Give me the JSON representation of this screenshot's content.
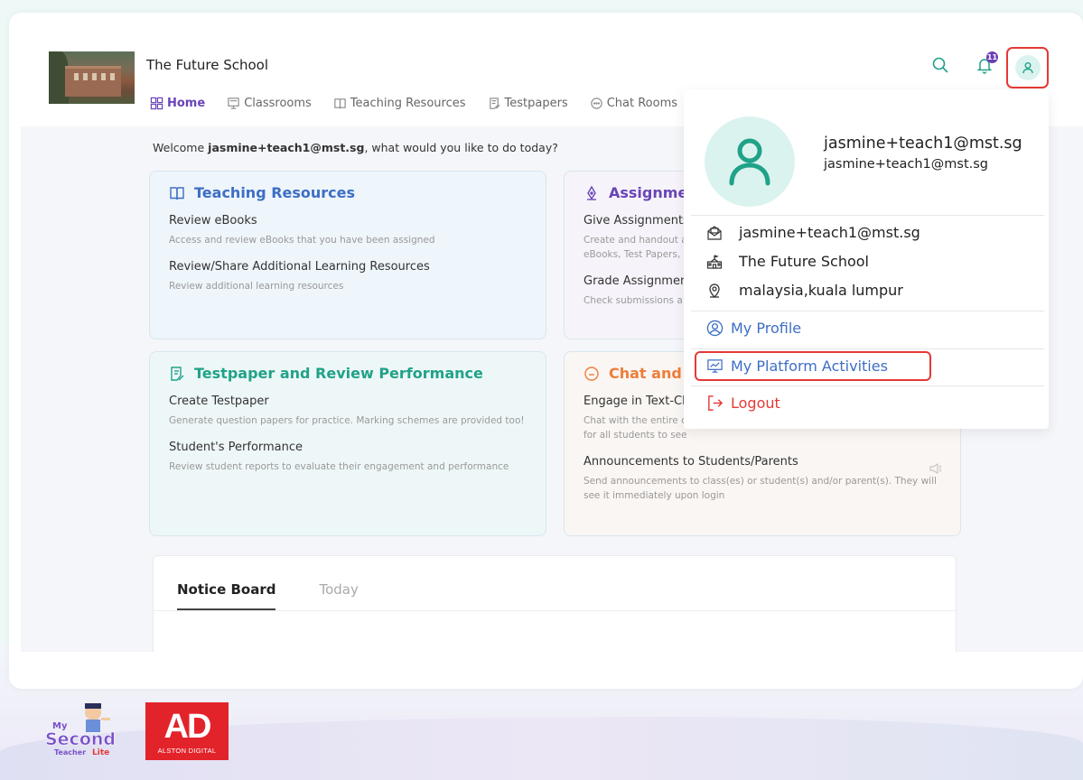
{
  "header": {
    "school_name": "The Future School",
    "notification_count": "11"
  },
  "nav": {
    "items": [
      {
        "label": "Home",
        "icon": "grid-icon",
        "active": true
      },
      {
        "label": "Classrooms",
        "icon": "classroom-icon"
      },
      {
        "label": "Teaching Resources",
        "icon": "book-icon"
      },
      {
        "label": "Testpapers",
        "icon": "testpaper-icon"
      },
      {
        "label": "Chat Rooms",
        "icon": "chat-icon"
      }
    ]
  },
  "welcome": {
    "prefix": "Welcome ",
    "user": "jasmine+teach1@mst.sg",
    "suffix": ", what would you like to do today?"
  },
  "tiles": {
    "teaching": {
      "title": "Teaching Resources",
      "items": [
        {
          "title": "Review eBooks",
          "desc": "Access and review eBooks that you have been assigned"
        },
        {
          "title": "Review/Share Additional Learning Resources",
          "desc": "Review additional learning resources"
        }
      ]
    },
    "assignments": {
      "title": "Assignmen",
      "items": [
        {
          "title": "Give Assignments",
          "desc": "Create and handout a",
          "desc2": "eBooks, Test Papers,"
        },
        {
          "title": "Grade Assignment",
          "desc": "Check submissions a"
        }
      ]
    },
    "testpaper": {
      "title": "Testpaper and Review Performance",
      "items": [
        {
          "title": "Create Testpaper",
          "desc": "Generate question papers for practice. Marking schemes are provided too!"
        },
        {
          "title": "Student's Performance",
          "desc": "Review student reports to evaluate their engagement and performance"
        }
      ]
    },
    "chat": {
      "title": "Chat and A",
      "items": [
        {
          "title": "Engage in Text-Ch",
          "desc": "Chat with the entire c",
          "desc2": "for all students to see"
        },
        {
          "title": "Announcements to Students/Parents",
          "desc": "Send announcements to class(es) or student(s) and/or parent(s). They will",
          "desc2": "see it immediately upon login"
        }
      ]
    }
  },
  "notice": {
    "tab_active": "Notice Board",
    "tab_inactive": "Today"
  },
  "dropdown": {
    "name": "jasmine+teach1@mst.sg",
    "email": "jasmine+teach1@mst.sg",
    "info_email": "jasmine+teach1@mst.sg",
    "info_school": "The Future School",
    "info_location": "malaysia,kuala lumpur",
    "my_profile": "My Profile",
    "my_platform_activities": "My Platform Activities",
    "logout": "Logout"
  },
  "footer": {
    "ad_logo_text": "AD",
    "ad_logo_sub": "ALSTON DIGITAL",
    "mst_logo_text": "My Second Teacher Lite"
  },
  "colors": {
    "accent_purple": "#6a44b8",
    "accent_teal": "#20a288",
    "accent_blue": "#3d6ec5",
    "accent_orange": "#ee7d3a",
    "highlight_red": "#e53935"
  }
}
